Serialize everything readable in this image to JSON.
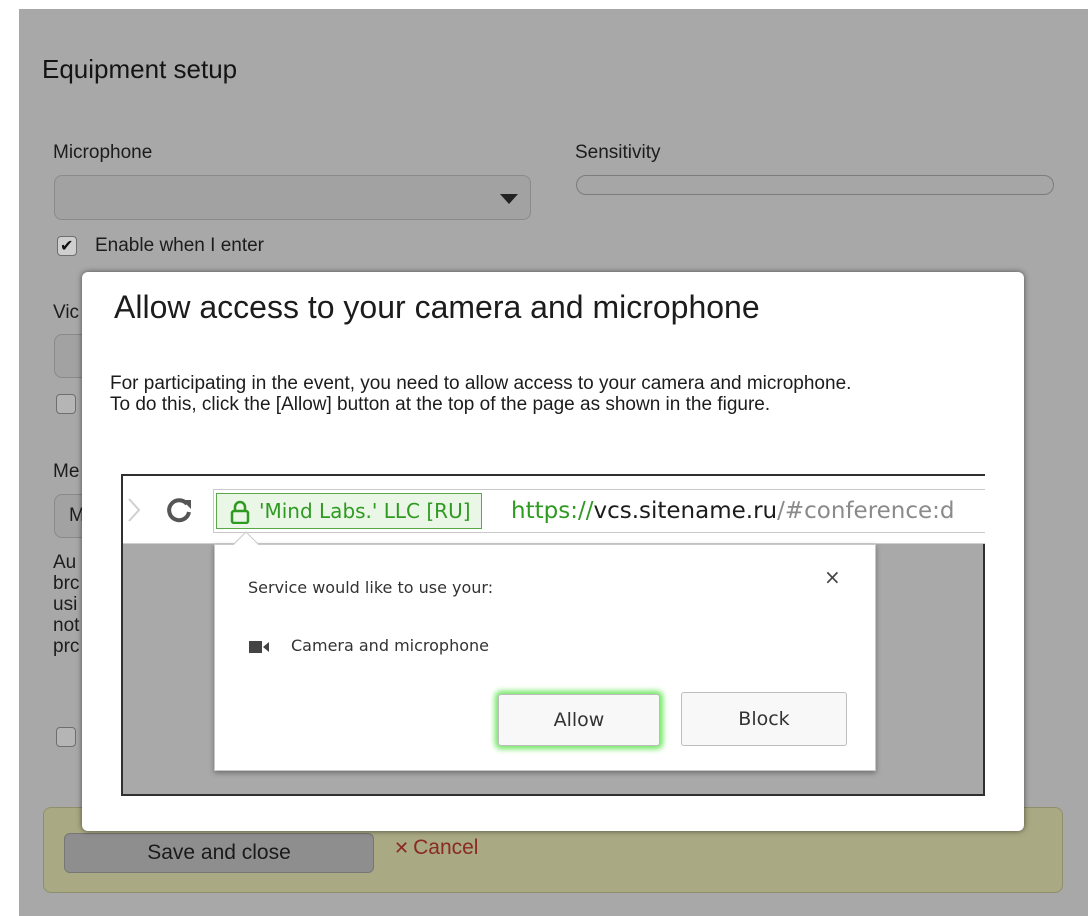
{
  "page": {
    "title": "Equipment setup",
    "microphone_label": "Microphone",
    "sensitivity_label": "Sensitivity",
    "enable_label": "Enable when I enter",
    "enable_checked": true,
    "video_label_peek": "Vic",
    "media_label_peek": "Me",
    "media_select_peek": "M",
    "note_peek": [
      "Au",
      "brc",
      "usi",
      "not",
      "prc"
    ]
  },
  "footer": {
    "save_label": "Save and close",
    "cancel_label": "Cancel",
    "cancel_icon": "close-icon",
    "cancel_color": "#8a2a21"
  },
  "modal": {
    "title": "Allow access to your camera and microphone",
    "text_line1": "For participating in the event, you need to allow access to your camera and microphone.",
    "text_line2": "To do this, click the [Allow] button at the top of the page as shown in the figure."
  },
  "figure": {
    "secure_label": "'Mind Labs.' LLC [RU]",
    "url_protocol": "https://",
    "url_host": "vcs.sitename.ru",
    "url_path": "/#conference:d",
    "popup_message": "Service would like to use your:",
    "close_symbol": "×",
    "permission_label": "Camera and microphone",
    "allow_label": "Allow",
    "block_label": "Block",
    "accent_green": "#2f9a22",
    "glow_green": "#6ee85f"
  }
}
